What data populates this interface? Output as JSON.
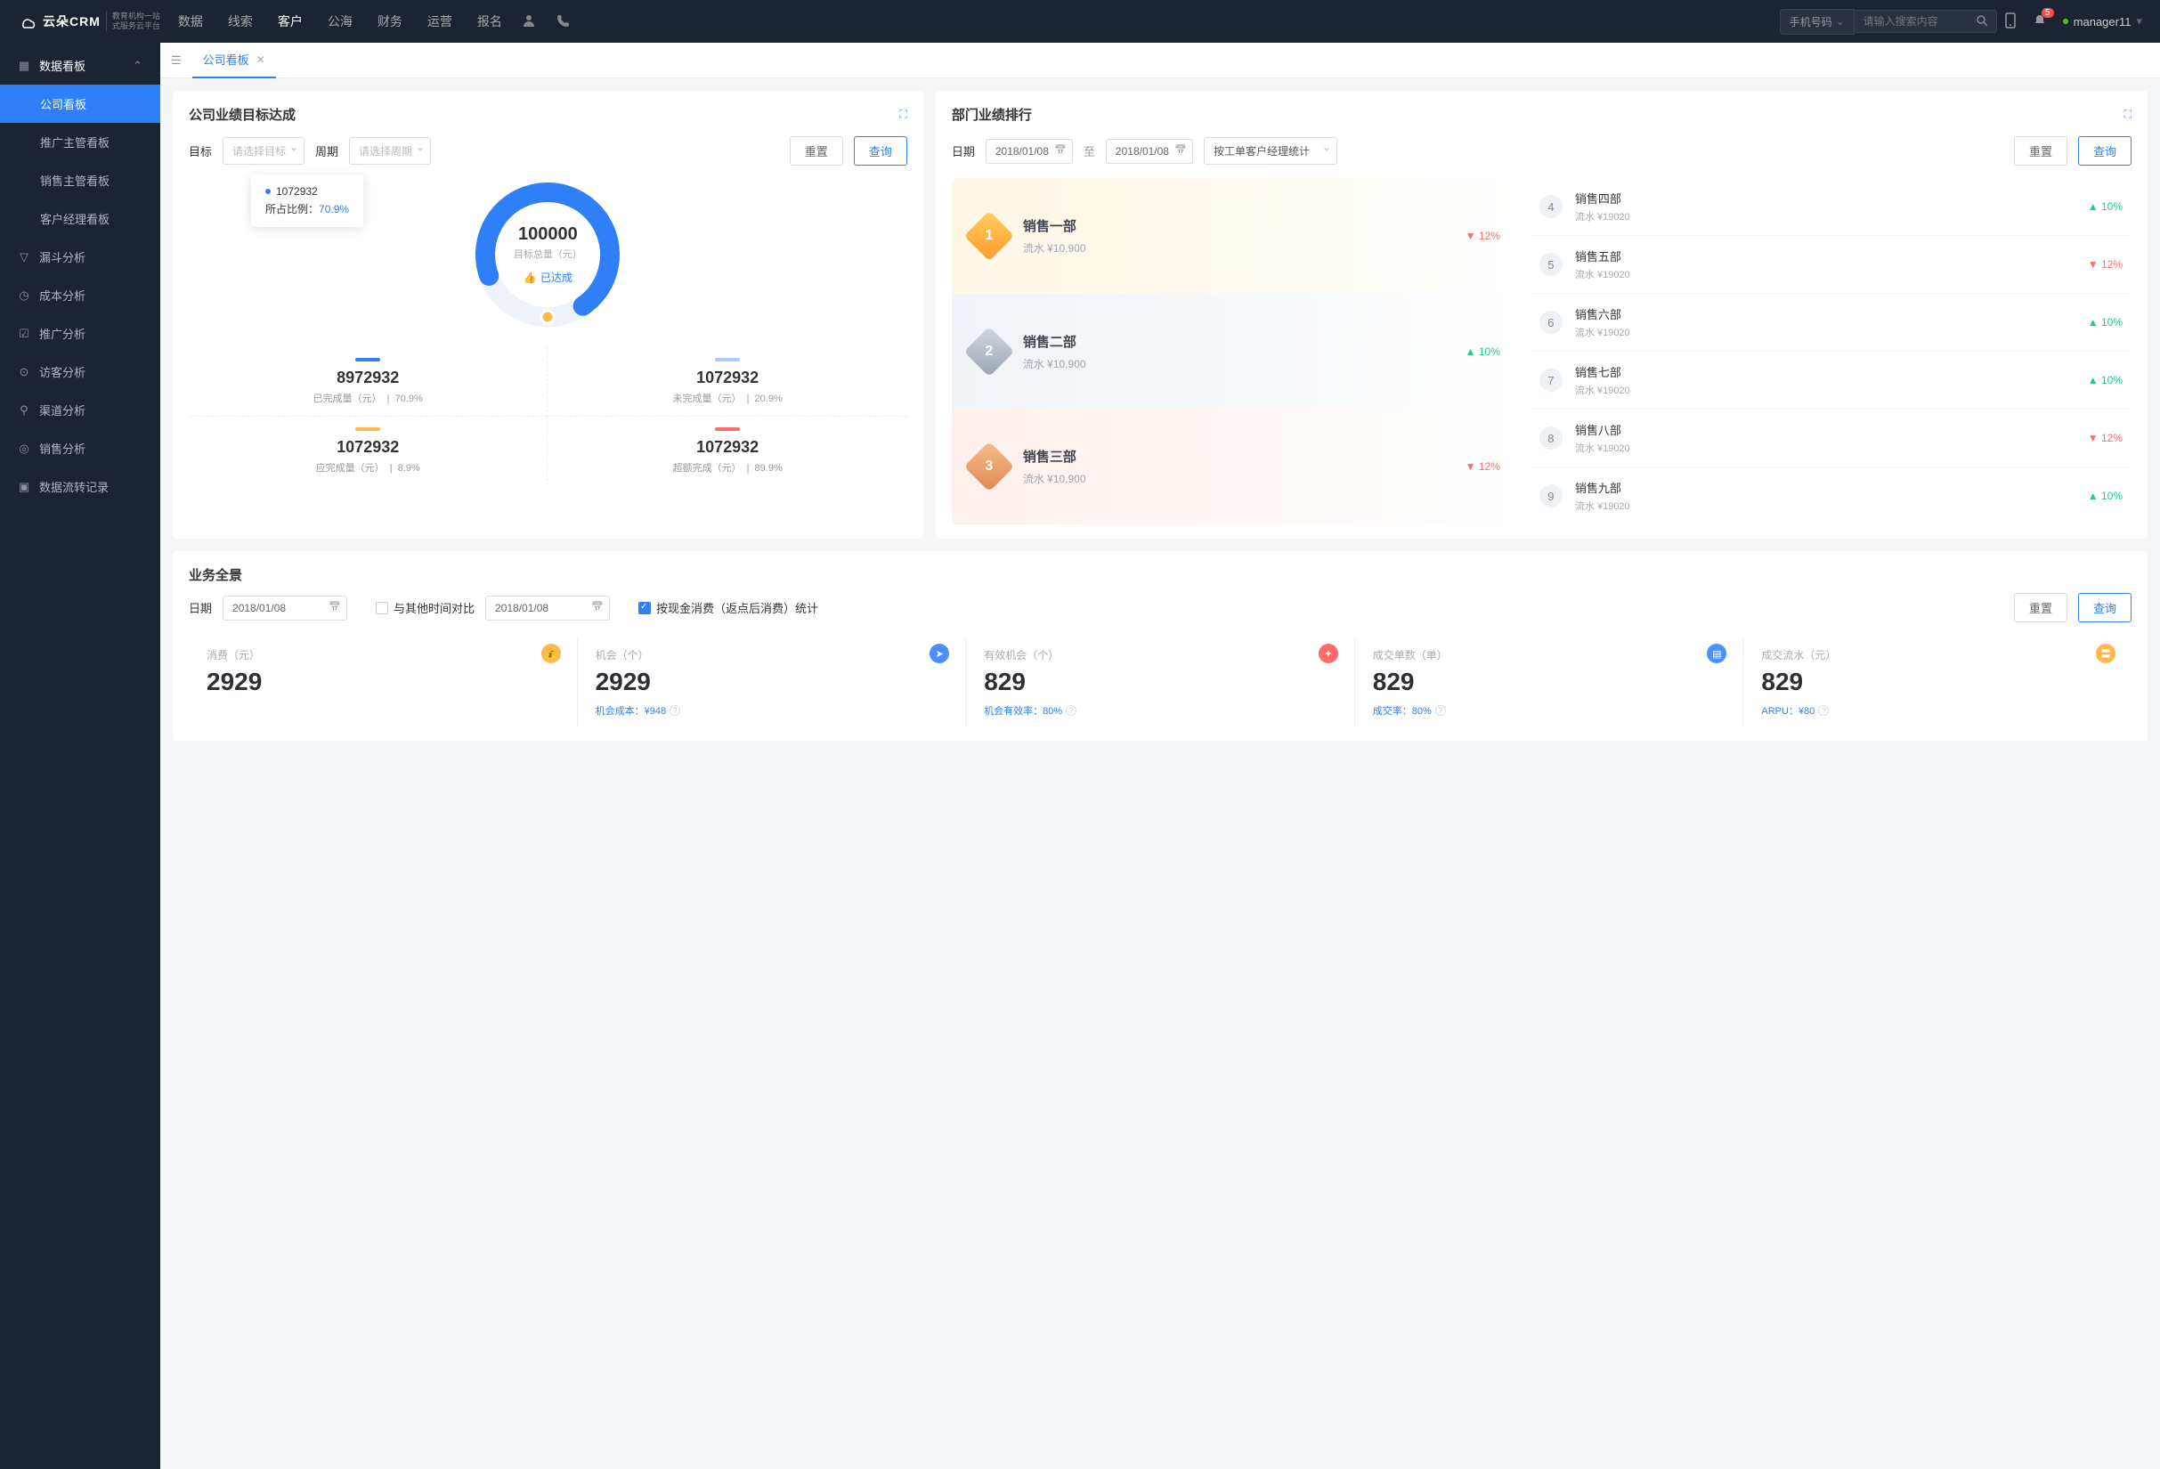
{
  "header": {
    "brand_main": "云朵CRM",
    "brand_sub1": "教育机构一站",
    "brand_sub2": "式服务云平台",
    "nav": [
      "数据",
      "线索",
      "客户",
      "公海",
      "财务",
      "运营",
      "报名"
    ],
    "nav_active_index": 2,
    "search_prefix": "手机号码",
    "search_placeholder": "请输入搜索内容",
    "notif_count": "5",
    "user": "manager11"
  },
  "sidebar": {
    "header": "数据看板",
    "sub": [
      "公司看板",
      "推广主管看板",
      "销售主管看板",
      "客户经理看板"
    ],
    "sub_active": 0,
    "items": [
      "漏斗分析",
      "成本分析",
      "推广分析",
      "访客分析",
      "渠道分析",
      "销售分析",
      "数据流转记录"
    ]
  },
  "tab": {
    "label": "公司看板"
  },
  "goal": {
    "title": "公司业绩目标达成",
    "target_label": "目标",
    "target_placeholder": "请选择目标",
    "period_label": "周期",
    "period_placeholder": "请选择周期",
    "reset": "重置",
    "query": "查询",
    "tooltip_value": "1072932",
    "tooltip_ratio_label": "所占比例：",
    "tooltip_ratio": "70.9%",
    "total": "100000",
    "total_label": "目标总量（元）",
    "achieved": "已达成",
    "stats": [
      {
        "color": "#2e7ff8",
        "num": "8972932",
        "label": "已完成量（元）",
        "pct": "70.9%"
      },
      {
        "color": "#a8ccff",
        "num": "1072932",
        "label": "未完成量（元）",
        "pct": "20.9%"
      },
      {
        "color": "#ffb84d",
        "num": "1072932",
        "label": "应完成量（元）",
        "pct": "8.9%"
      },
      {
        "color": "#ff6b6b",
        "num": "1072932",
        "label": "超额完成（元）",
        "pct": "89.9%"
      }
    ]
  },
  "rank": {
    "title": "部门业绩排行",
    "date_label": "日期",
    "date_from": "2018/01/08",
    "date_sep": "至",
    "date_to": "2018/01/08",
    "group_placeholder": "按工单客户经理统计",
    "reset": "重置",
    "query": "查询",
    "top": [
      {
        "n": "1",
        "name": "销售一部",
        "flow": "流水 ¥10,900",
        "pct": "12%",
        "dir": "down"
      },
      {
        "n": "2",
        "name": "销售二部",
        "flow": "流水 ¥10,900",
        "pct": "10%",
        "dir": "up"
      },
      {
        "n": "3",
        "name": "销售三部",
        "flow": "流水 ¥10,900",
        "pct": "12%",
        "dir": "down"
      }
    ],
    "list": [
      {
        "n": "4",
        "name": "销售四部",
        "flow": "流水 ¥19020",
        "pct": "10%",
        "dir": "up"
      },
      {
        "n": "5",
        "name": "销售五部",
        "flow": "流水 ¥19020",
        "pct": "12%",
        "dir": "down"
      },
      {
        "n": "6",
        "name": "销售六部",
        "flow": "流水 ¥19020",
        "pct": "10%",
        "dir": "up"
      },
      {
        "n": "7",
        "name": "销售七部",
        "flow": "流水 ¥19020",
        "pct": "10%",
        "dir": "up"
      },
      {
        "n": "8",
        "name": "销售八部",
        "flow": "流水 ¥19020",
        "pct": "12%",
        "dir": "down"
      },
      {
        "n": "9",
        "name": "销售九部",
        "flow": "流水 ¥19020",
        "pct": "10%",
        "dir": "up"
      }
    ]
  },
  "overview": {
    "title": "业务全景",
    "date_label": "日期",
    "date1": "2018/01/08",
    "compare_label": "与其他时间对比",
    "date2": "2018/01/08",
    "stat_label": "按现金消费（返点后消费）统计",
    "reset": "重置",
    "query": "查询",
    "cards": [
      {
        "label": "消费（元）",
        "num": "2929",
        "sub": "",
        "color": "#ffb84d",
        "icon": "💰"
      },
      {
        "label": "机会（个）",
        "num": "2929",
        "sub": "机会成本：¥948",
        "color": "#4a90ff",
        "icon": "➤"
      },
      {
        "label": "有效机会（个）",
        "num": "829",
        "sub": "机会有效率：80%",
        "color": "#ff6b6b",
        "icon": "✦"
      },
      {
        "label": "成交单数（单）",
        "num": "829",
        "sub": "成交率：80%",
        "color": "#4a90ff",
        "icon": "▤"
      },
      {
        "label": "成交流水（元）",
        "num": "829",
        "sub": "ARPU：¥80",
        "color": "#ffb84d",
        "icon": "〓"
      }
    ]
  },
  "chart_data": {
    "type": "pie",
    "title": "公司业绩目标达成",
    "total": 100000,
    "total_label": "目标总量（元）",
    "series": [
      {
        "name": "已完成量（元）",
        "value": 8972932,
        "pct": 70.9,
        "color": "#2e7ff8"
      },
      {
        "name": "未完成量（元）",
        "value": 1072932,
        "pct": 20.9,
        "color": "#a8ccff"
      },
      {
        "name": "应完成量（元）",
        "value": 1072932,
        "pct": 8.9,
        "color": "#ffb84d"
      },
      {
        "name": "超额完成（元）",
        "value": 1072932,
        "pct": 89.9,
        "color": "#ff6b6b"
      }
    ],
    "highlighted": {
      "value": 1072932,
      "pct": 70.9
    }
  }
}
